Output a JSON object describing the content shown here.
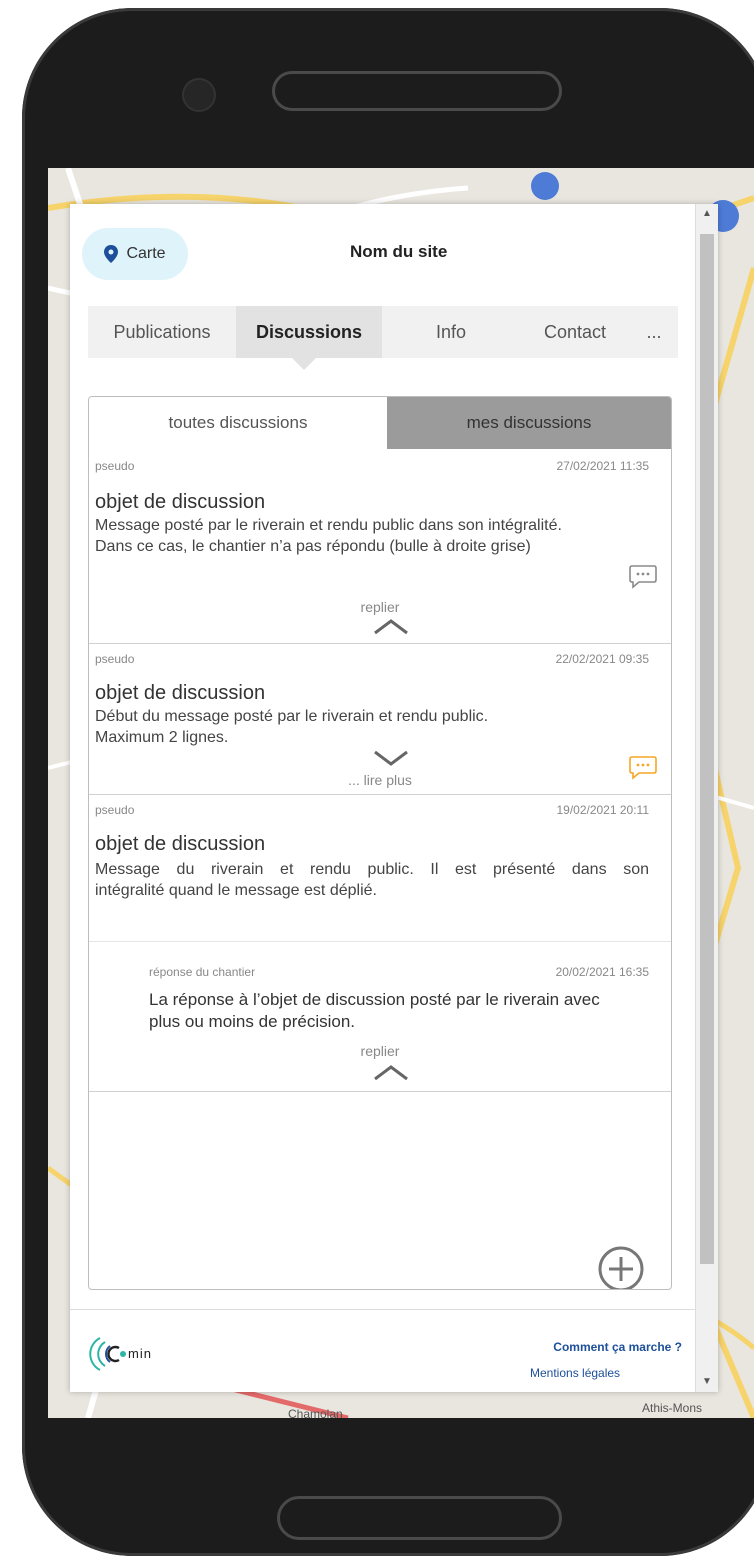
{
  "header": {
    "map_button_label": "Carte",
    "site_name": "Nom du site"
  },
  "tabs": [
    {
      "label": "Publications",
      "active": false
    },
    {
      "label": "Discussions",
      "active": true
    },
    {
      "label": "Info",
      "active": false
    },
    {
      "label": "Contact",
      "active": false
    },
    {
      "label": "...",
      "active": false
    }
  ],
  "subtabs": {
    "all": "toutes discussions",
    "mine": "mes discussions"
  },
  "discussions": [
    {
      "author": "pseudo",
      "date": "27/02/2021 11:35",
      "subject": "objet de discussion",
      "line1": "Message posté par le riverain et rendu public dans son intégralité.",
      "line2": "Dans ce cas, le chantier n’a pas répondu (bulle à droite grise)",
      "toggle": "replier",
      "bubble_color": "#8a8a8a"
    },
    {
      "author": "pseudo",
      "date": "22/02/2021 09:35",
      "subject": "objet de discussion",
      "line1": "Début du message posté par le riverain et rendu public.",
      "line2": "Maximum 2 lignes.",
      "toggle": "... lire plus",
      "bubble_color": "#f5a623"
    },
    {
      "author": "pseudo",
      "date": "19/02/2021 20:11",
      "subject": "objet de discussion",
      "line1": "Message du riverain et rendu public. Il est présenté dans son",
      "line2": "intégralité quand le message est déplié.",
      "reply": {
        "author": "réponse du chantier",
        "date": "20/02/2021 16:35",
        "line1": "La réponse à l’objet de discussion posté par le riverain avec",
        "line2": "plus ou moins de précision."
      },
      "toggle": "replier"
    }
  ],
  "footer": {
    "logo_text": "min",
    "how_it_works": "Comment ça marche ?",
    "legal": "Mentions légales"
  },
  "map_labels": [
    "Athis-Mons",
    "Chamolan"
  ],
  "colors": {
    "accent": "#1d4f9a",
    "map_button_bg": "#dff3fb",
    "active_tab_bg": "#e2e2e2",
    "mine_tab_bg": "#9b9b9b",
    "logo_teal": "#2bb5a5"
  }
}
